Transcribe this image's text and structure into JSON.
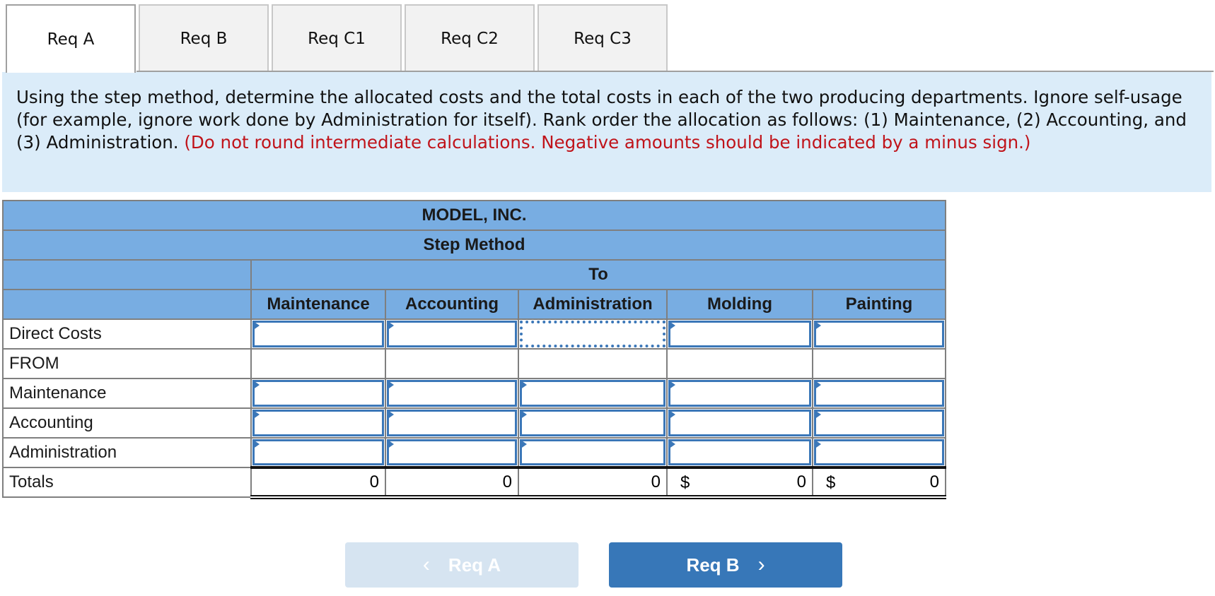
{
  "tabs": [
    {
      "label": "Req A",
      "active": true
    },
    {
      "label": "Req B",
      "active": false
    },
    {
      "label": "Req C1",
      "active": false
    },
    {
      "label": "Req C2",
      "active": false
    },
    {
      "label": "Req C3",
      "active": false
    }
  ],
  "instructions": {
    "text": "Using the step method, determine the allocated costs and the total costs in each of the two producing departments. Ignore self-usage (for example, ignore work done by Administration for itself). Rank order the allocation as follows: (1) Maintenance, (2) Accounting, and (3) Administration. ",
    "note": "(Do not round intermediate calculations. Negative amounts should be indicated by a minus sign.)",
    "note_color": "#c0131a"
  },
  "table": {
    "title": "MODEL, INC.",
    "subtitle": "Step Method",
    "group_header": "To",
    "columns": [
      "Maintenance",
      "Accounting",
      "Administration",
      "Molding",
      "Painting"
    ],
    "rows": [
      {
        "label": "Direct Costs",
        "values": [
          "",
          "",
          "",
          "",
          ""
        ]
      },
      {
        "label": "FROM",
        "values": [
          "",
          "",
          "",
          "",
          ""
        ]
      },
      {
        "label": "Maintenance",
        "values": [
          "",
          "",
          "",
          "",
          ""
        ]
      },
      {
        "label": "Accounting",
        "values": [
          "",
          "",
          "",
          "",
          ""
        ]
      },
      {
        "label": "Administration",
        "values": [
          "",
          "",
          "",
          "",
          ""
        ]
      }
    ],
    "totals": {
      "label": "Totals",
      "values": [
        "0",
        "0",
        "0",
        "0",
        "0"
      ],
      "currency_symbol": "$"
    }
  },
  "nav": {
    "prev_label": "Req A",
    "next_label": "Req B",
    "prev_icon": "chevron-left-icon",
    "next_icon": "chevron-right-icon"
  },
  "colors": {
    "header_bg": "#78ade2",
    "instruction_bg": "#dbecf9",
    "input_border": "#3b77b8",
    "next_button": "#3777b8",
    "prev_button_disabled": "#d6e4f1"
  }
}
